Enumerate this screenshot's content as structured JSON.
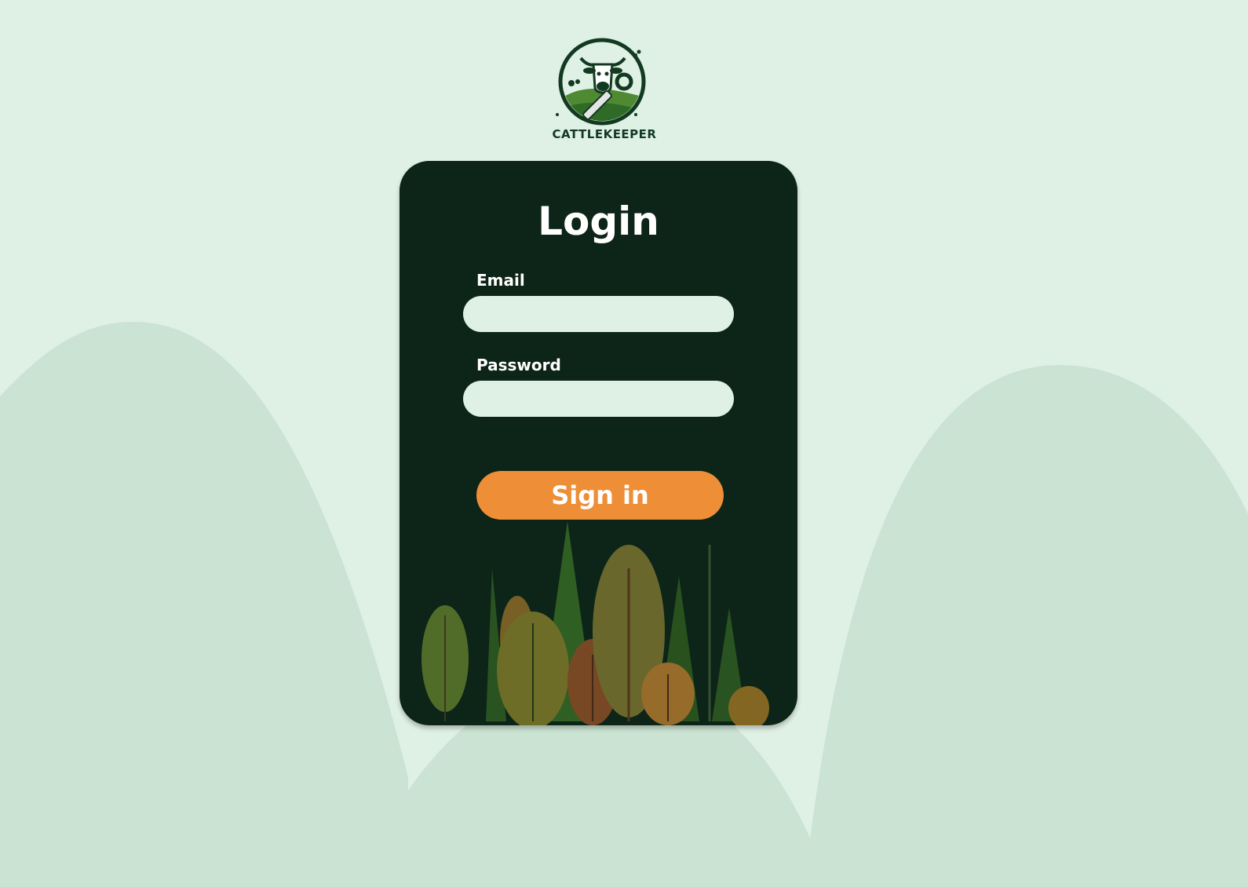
{
  "brand": {
    "name": "CATTLEKEEPER",
    "logo_icon": "cow-wrench-logo-icon"
  },
  "login_card": {
    "title": "Login",
    "email": {
      "label": "Email",
      "value": "",
      "placeholder": ""
    },
    "password": {
      "label": "Password",
      "value": "",
      "placeholder": ""
    },
    "submit_label": "Sign in",
    "illustration": "forest-illustration"
  },
  "colors": {
    "background": "#dff0e5",
    "hills": "#cbe3d3",
    "card": "#0d2418",
    "input": "#dff0e5",
    "button": "#ee8e36",
    "text_on_dark": "#ffffff"
  }
}
